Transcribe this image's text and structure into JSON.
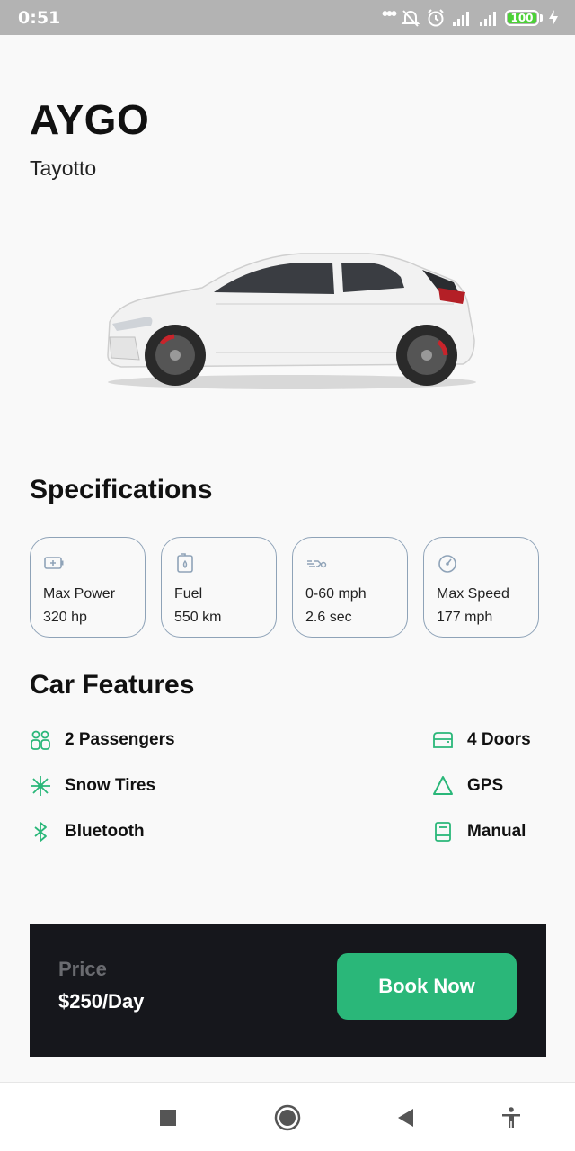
{
  "status_bar": {
    "time": "0:51",
    "battery": "100"
  },
  "header": {
    "title": "AYGO",
    "brand": "Tayotto"
  },
  "car": {
    "image": "white-hatchback-car"
  },
  "specifications": {
    "title": "Specifications",
    "items": [
      {
        "label": "Max Power",
        "value": "320 hp",
        "icon": "battery-icon"
      },
      {
        "label": "Fuel",
        "value": "550 km",
        "icon": "fuel-icon"
      },
      {
        "label": "0-60 mph",
        "value": "2.6 sec",
        "icon": "speed-lines-icon"
      },
      {
        "label": "Max Speed",
        "value": "177 mph",
        "icon": "speedometer-icon"
      }
    ]
  },
  "features": {
    "title": "Car Features",
    "items": [
      {
        "label": "2 Passengers",
        "icon": "passengers-icon"
      },
      {
        "label": "4 Doors",
        "icon": "doors-icon"
      },
      {
        "label": "Snow Tires",
        "icon": "snowflake-icon"
      },
      {
        "label": "GPS",
        "icon": "navigation-icon"
      },
      {
        "label": "Bluetooth",
        "icon": "bluetooth-icon"
      },
      {
        "label": "Manual",
        "icon": "manual-book-icon"
      }
    ]
  },
  "booking": {
    "price_label": "Price",
    "price_value": "$250/Day",
    "button_label": "Book Now"
  },
  "colors": {
    "accent": "#2ab779",
    "panel": "#16171c",
    "card_border": "#8fa3b8"
  }
}
